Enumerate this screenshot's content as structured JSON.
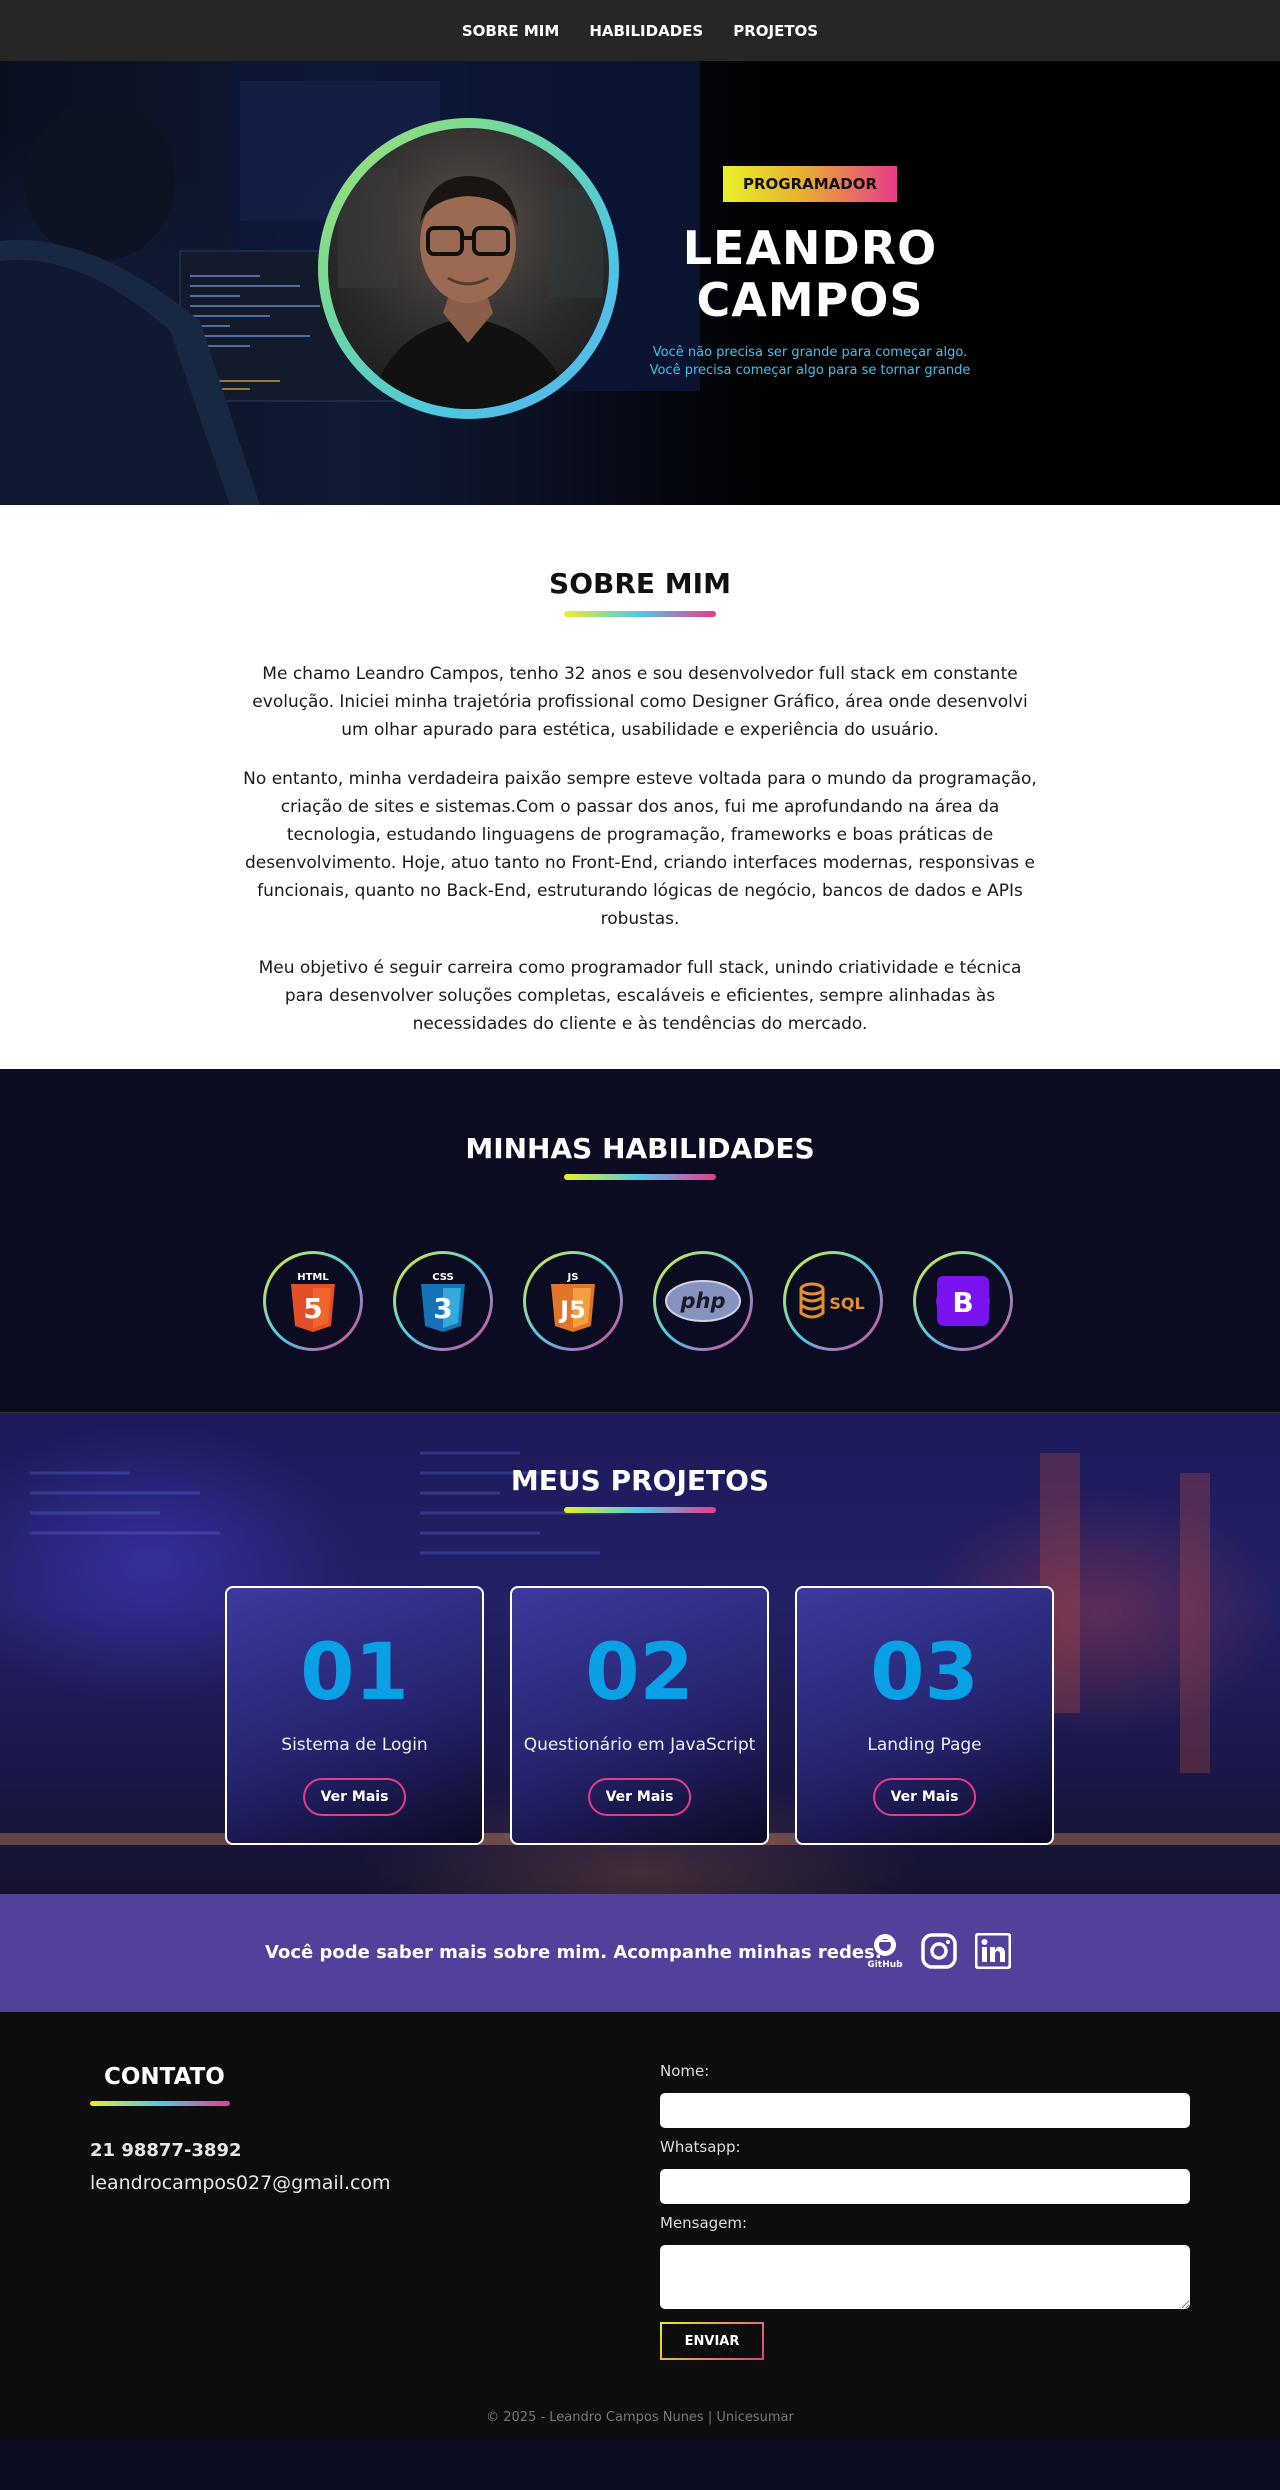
{
  "nav": {
    "items": [
      "SOBRE MIM",
      "HABILIDADES",
      "PROJETOS"
    ]
  },
  "hero": {
    "badge": "PROGRAMADOR",
    "name_line1": "LEANDRO",
    "name_line2": "CAMPOS",
    "quote_line1": "Você não precisa ser grande para começar algo.",
    "quote_line2": "Você precisa começar algo para se tornar grande"
  },
  "sobre": {
    "title": "SOBRE MIM",
    "paragraphs": [
      "Me chamo Leandro Campos, tenho 32 anos e sou desenvolvedor full stack em constante evolução. Iniciei minha trajetória profissional como Designer Gráfico, área onde desenvolvi um olhar apurado para estética, usabilidade e experiência do usuário.",
      "No entanto, minha verdadeira paixão sempre esteve voltada para o mundo da programação, criação de sites e sistemas.Com o passar dos anos, fui me aprofundando na área da tecnologia, estudando linguagens de programação, frameworks e boas práticas de desenvolvimento. Hoje, atuo tanto no Front-End, criando interfaces modernas, responsivas e funcionais, quanto no Back-End, estruturando lógicas de negócio, bancos de dados e APIs robustas.",
      "Meu objetivo é seguir carreira como programador full stack, unindo criatividade e técnica para desenvolver soluções completas, escaláveis e eficientes, sempre alinhadas às necessidades do cliente e às tendências do mercado."
    ]
  },
  "habilidades": {
    "title": "MINHAS HABILIDADES",
    "skills": [
      {
        "icon": "html5-icon",
        "label": "HTML"
      },
      {
        "icon": "css3-icon",
        "label": "CSS"
      },
      {
        "icon": "js-icon",
        "label": "JS"
      },
      {
        "icon": "php-icon",
        "label": "php"
      },
      {
        "icon": "sql-icon",
        "label": "SQL"
      },
      {
        "icon": "bootstrap-icon",
        "label": "B"
      }
    ]
  },
  "projetos": {
    "title": "MEUS PROJETOS",
    "cards": [
      {
        "num": "01",
        "name": "Sistema de Login",
        "button": "Ver Mais"
      },
      {
        "num": "02",
        "name": "Questionário em JavaScript",
        "button": "Ver Mais"
      },
      {
        "num": "03",
        "name": "Landing Page",
        "button": "Ver Mais"
      }
    ]
  },
  "redes": {
    "text": "Você pode saber mais sobre mim. Acompanhe minhas redes:",
    "icons": [
      "github-icon",
      "instagram-icon",
      "linkedin-icon"
    ],
    "github_label": "GitHub"
  },
  "contato": {
    "title": "CONTATO",
    "phone": "21 98877-3892",
    "email": "leandrocampos027@gmail.com",
    "form": {
      "name_label": "Nome:",
      "whatsapp_label": "Whatsapp:",
      "message_label": "Mensagem:",
      "send_label": "ENVIAR"
    },
    "copyright": "© 2025 - Leandro Campos Nunes | Unicesumar"
  },
  "colors": {
    "accent_gradient": [
      "#e8f028",
      "#50c8e8",
      "#e83a8a"
    ],
    "project_number": "#0aa0e6",
    "redes_band": "#52409a",
    "quote": "#44c0ee"
  }
}
